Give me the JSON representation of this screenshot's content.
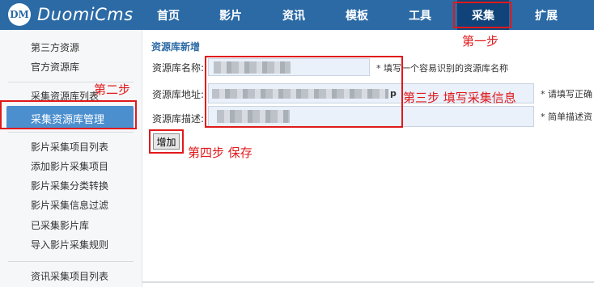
{
  "app": {
    "logo_mark": "DM",
    "logo_text": "DuomiCms"
  },
  "nav": [
    {
      "label": "首页"
    },
    {
      "label": "影片"
    },
    {
      "label": "资讯"
    },
    {
      "label": "模板"
    },
    {
      "label": "工具"
    },
    {
      "label": "采集"
    },
    {
      "label": "扩展"
    }
  ],
  "sidebar": {
    "group1": [
      "第三方资源",
      "官方资源库"
    ],
    "group2": [
      "采集资源库列表",
      "采集资源库管理"
    ],
    "group3": [
      "影片采集项目列表",
      "添加影片采集项目",
      "影片采集分类转换",
      "影片采集信息过滤",
      "已采集影片库",
      "导入影片采集规则"
    ],
    "group4": [
      "资讯采集项目列表"
    ]
  },
  "form": {
    "title": "资源库新增",
    "name_label": "资源库名称:",
    "name_hint": "* 填写一个容易识别的资源库名称",
    "url_label": "资源库地址:",
    "url_value_tail": "p",
    "url_hint": "* 请填写正确",
    "desc_label": "资源库描述:",
    "desc_hint": "* 简单描述资",
    "submit": "增加"
  },
  "annotations": {
    "step1": "第一步",
    "step2": "第二步",
    "step3": "第三步  填写采集信息",
    "step4": "第四步  保存"
  },
  "colors": {
    "topbar": "#2b6aa5",
    "active_nav": "#10437a",
    "active_side": "#4b8fcf",
    "annotation": "#e0191b"
  }
}
